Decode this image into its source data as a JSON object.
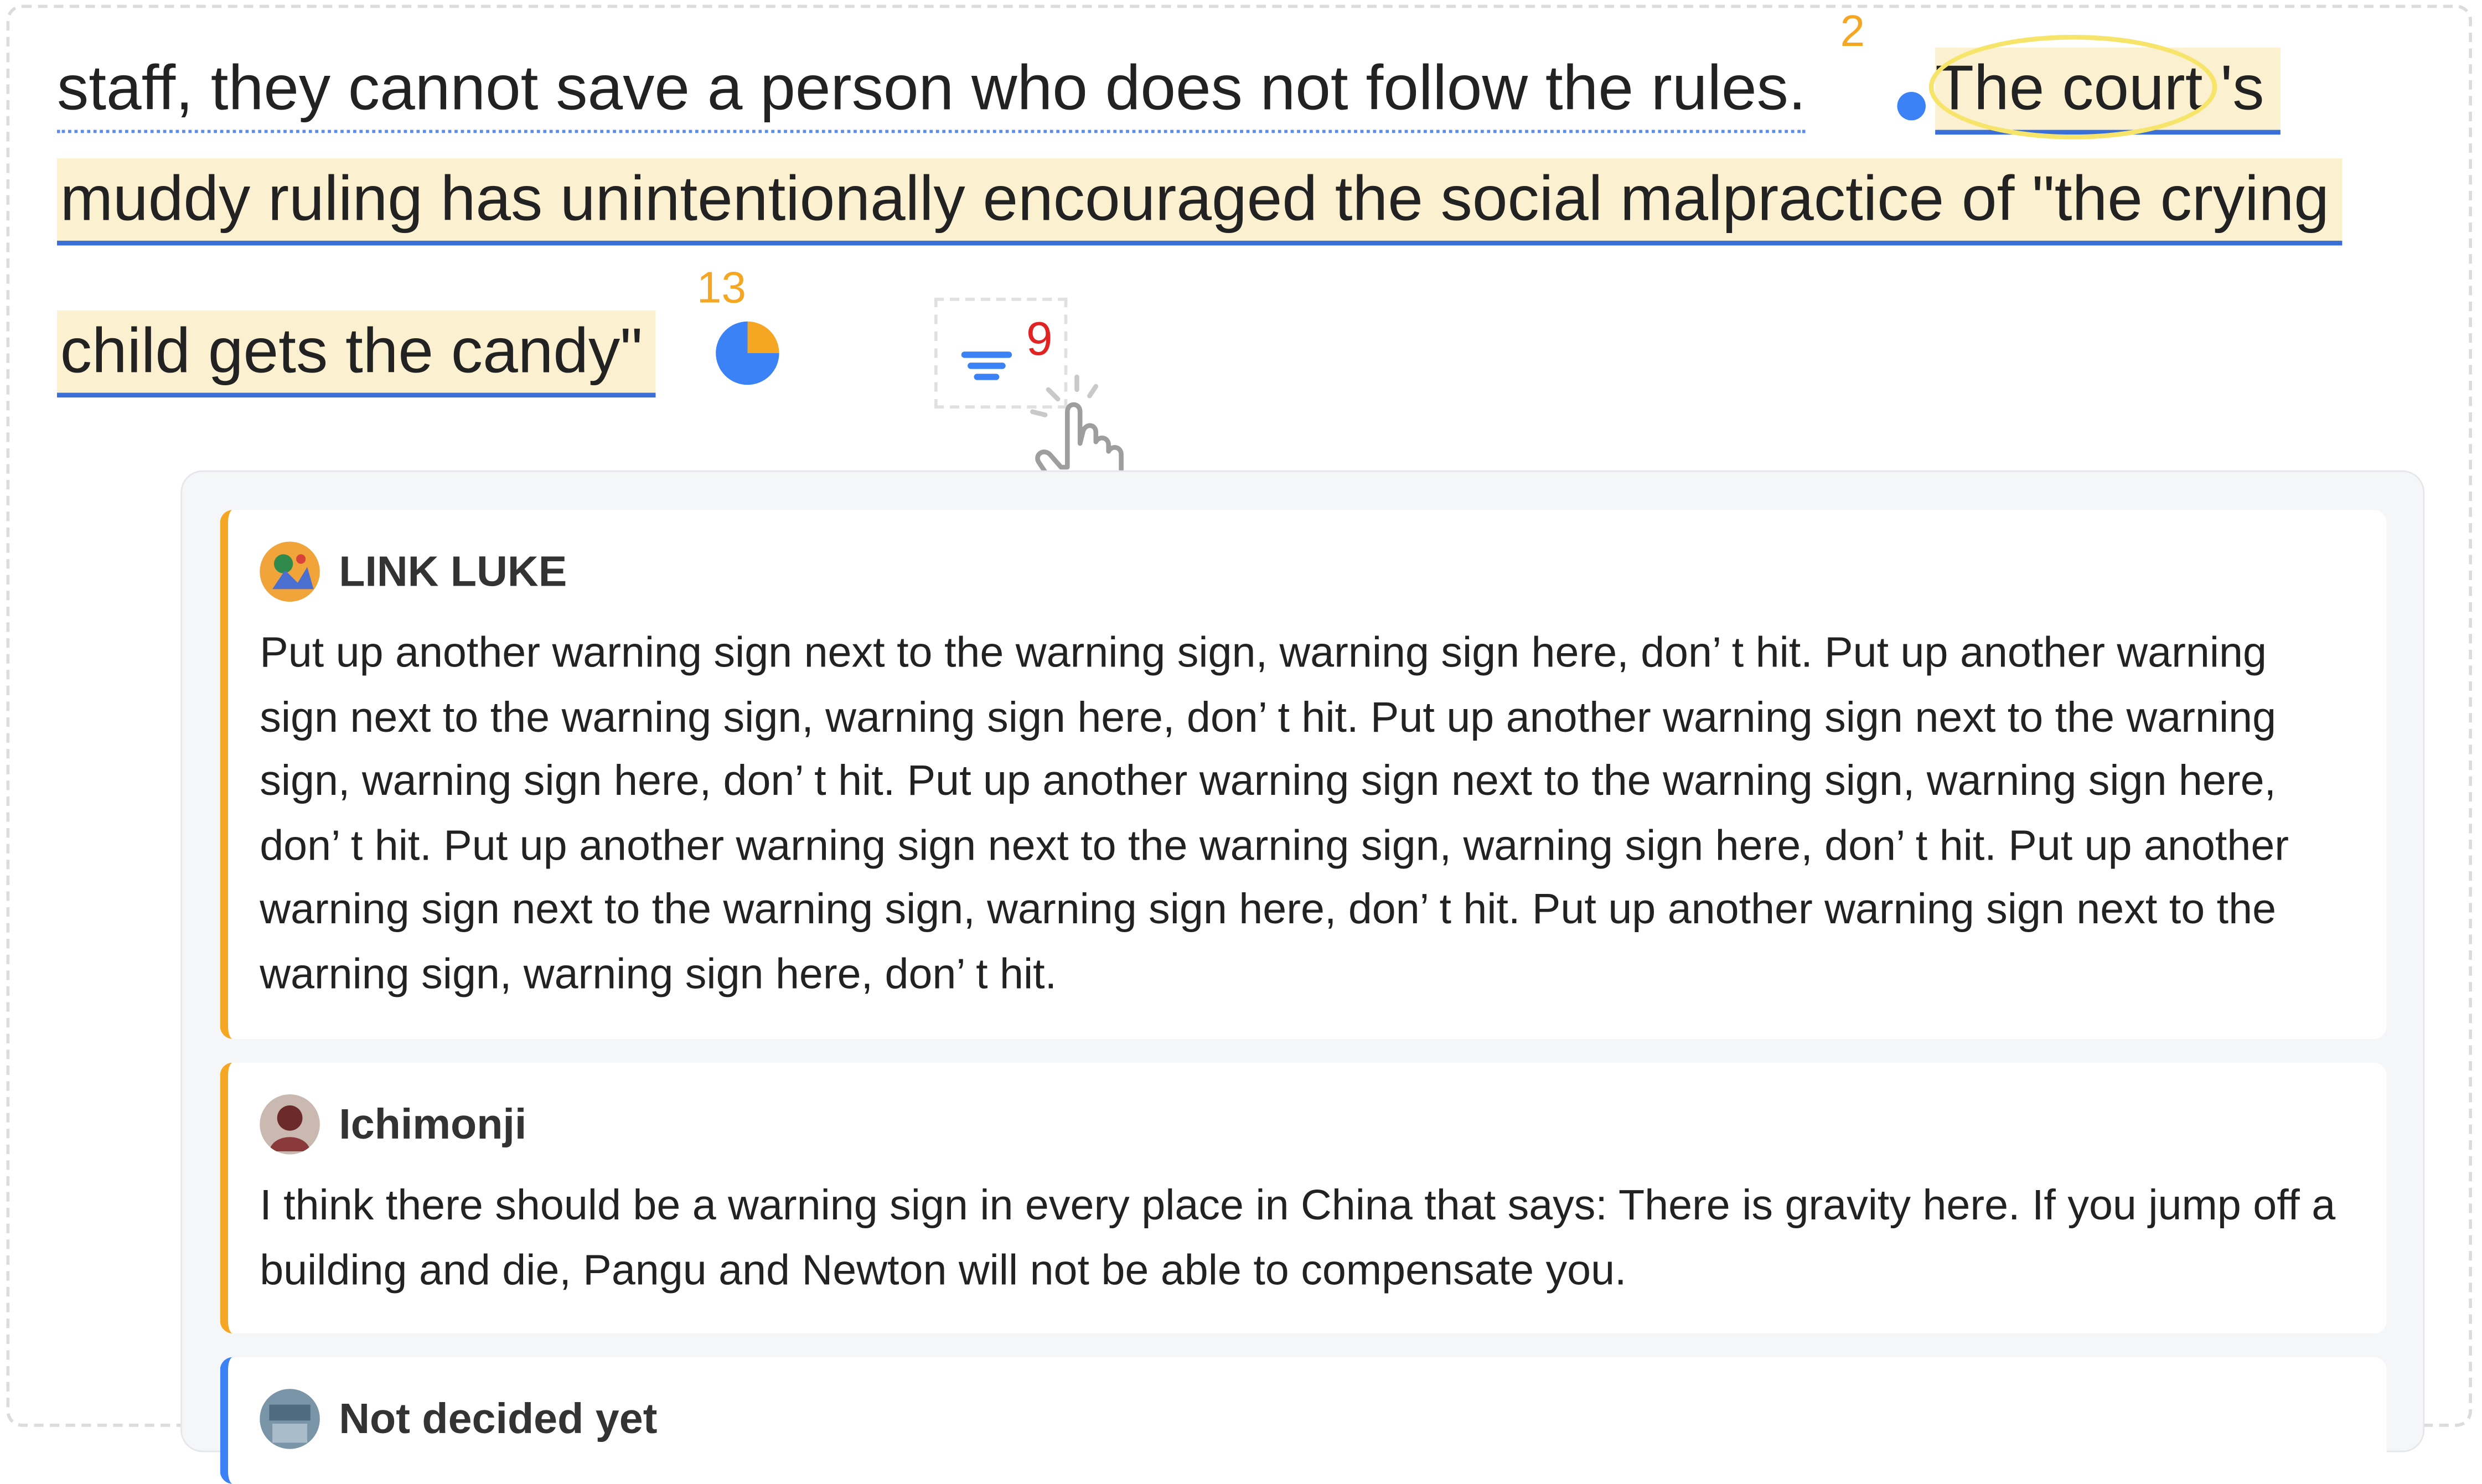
{
  "passage": {
    "line1": "staff, they cannot save a person who does not follow the rules.",
    "line1_highlight": "The court 's",
    "line2": "muddy ruling has unintentionally encouraged the social malpractice of \"the crying",
    "line3": "child gets the candy\"",
    "count_a": "2",
    "count_b": "13"
  },
  "filter": {
    "count": "9",
    "icon": "filter-lines-icon"
  },
  "comments": [
    {
      "user": "LINK LUKE",
      "text": "Put up another warning sign next to the warning sign, warning sign here, don’ t hit. Put up another warning sign next to the warning sign, warning sign here, don’ t hit. Put up another warning sign next to the warning sign, warning sign here, don’ t hit. Put up another warning sign next to the warning sign, warning sign here, don’ t hit. Put up another warning sign next to the warning sign, warning sign here, don’ t hit. Put up another warning sign next to the warning sign, warning sign here, don’ t hit. Put up another warning sign next to the warning sign, warning sign here, don’ t hit.",
      "accent": "#f5a623"
    },
    {
      "user": "Ichimonji",
      "text": "I think there should be a warning sign in every place in China that says: There is gravity here. If you jump off a building and die, Pangu and Newton will not be able to compensate you.",
      "accent": "#f5a623"
    },
    {
      "user": "Not decided yet",
      "text": "",
      "accent": "#3b82f6"
    }
  ],
  "colors": {
    "highlight": "#fbf0cf",
    "underline": "#3b6fd8",
    "orange": "#f5a623",
    "blue": "#3b82f6",
    "red": "#e02424"
  }
}
